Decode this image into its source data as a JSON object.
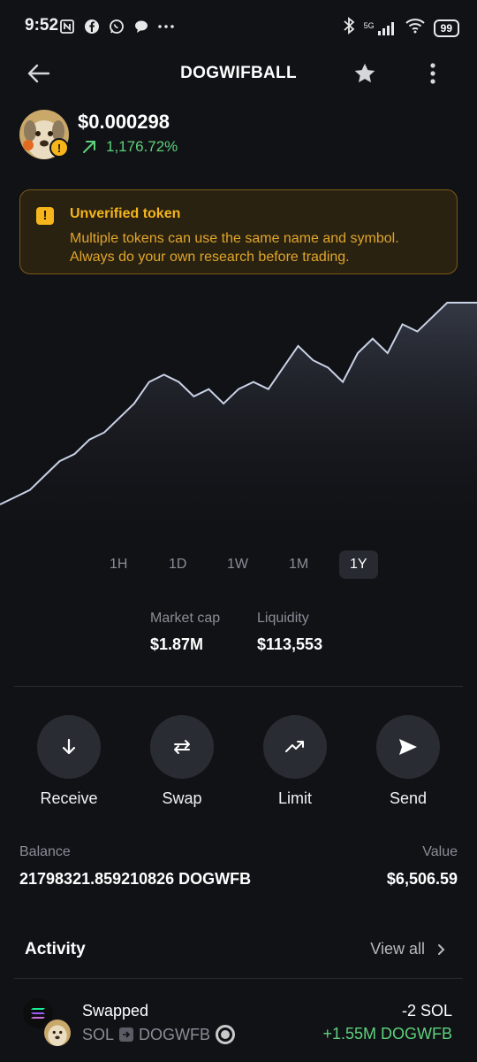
{
  "status_bar": {
    "time": "9:52",
    "network": "5G",
    "battery": "99"
  },
  "header": {
    "title": "DOGWIFBALL"
  },
  "token": {
    "price": "$0.000298",
    "change": "1,176.72%",
    "change_color": "#5ed27c"
  },
  "warning": {
    "title": "Unverified token",
    "line1": "Multiple tokens can use the same name and symbol.",
    "line2": "Always do your own research before trading.",
    "color": "#f5b51b"
  },
  "chart_data": {
    "type": "area",
    "y": [
      2e-05,
      3e-05,
      4e-05,
      6e-05,
      8e-05,
      9e-05,
      0.00011,
      0.00012,
      0.00014,
      0.00016,
      0.00019,
      0.0002,
      0.00019,
      0.00017,
      0.00018,
      0.00016,
      0.00018,
      0.00019,
      0.00018,
      0.00021,
      0.00024,
      0.00022,
      0.00021,
      0.00019,
      0.00023,
      0.00025,
      0.00023,
      0.00027,
      0.00026,
      0.00028,
      0.0003,
      0.0003,
      0.0003
    ],
    "range": "1Y",
    "grid": false
  },
  "range_tabs": [
    "1H",
    "1D",
    "1W",
    "1M",
    "1Y"
  ],
  "active_range": "1Y",
  "stats": {
    "market_cap_label": "Market cap",
    "market_cap_value": "$1.87M",
    "liquidity_label": "Liquidity",
    "liquidity_value": "$113,553"
  },
  "actions": {
    "receive": "Receive",
    "swap": "Swap",
    "limit": "Limit",
    "send": "Send"
  },
  "balance": {
    "balance_label": "Balance",
    "balance_value": "21798321.859210826 DOGWFB",
    "value_label": "Value",
    "value_value": "$6,506.59"
  },
  "activity": {
    "title": "Activity",
    "view_all": "View all",
    "items": [
      {
        "title": "Swapped",
        "from": "SOL",
        "to": "DOGWFB",
        "amount_out": "-2 SOL",
        "amount_in": "+1.55M DOGWFB"
      }
    ]
  }
}
